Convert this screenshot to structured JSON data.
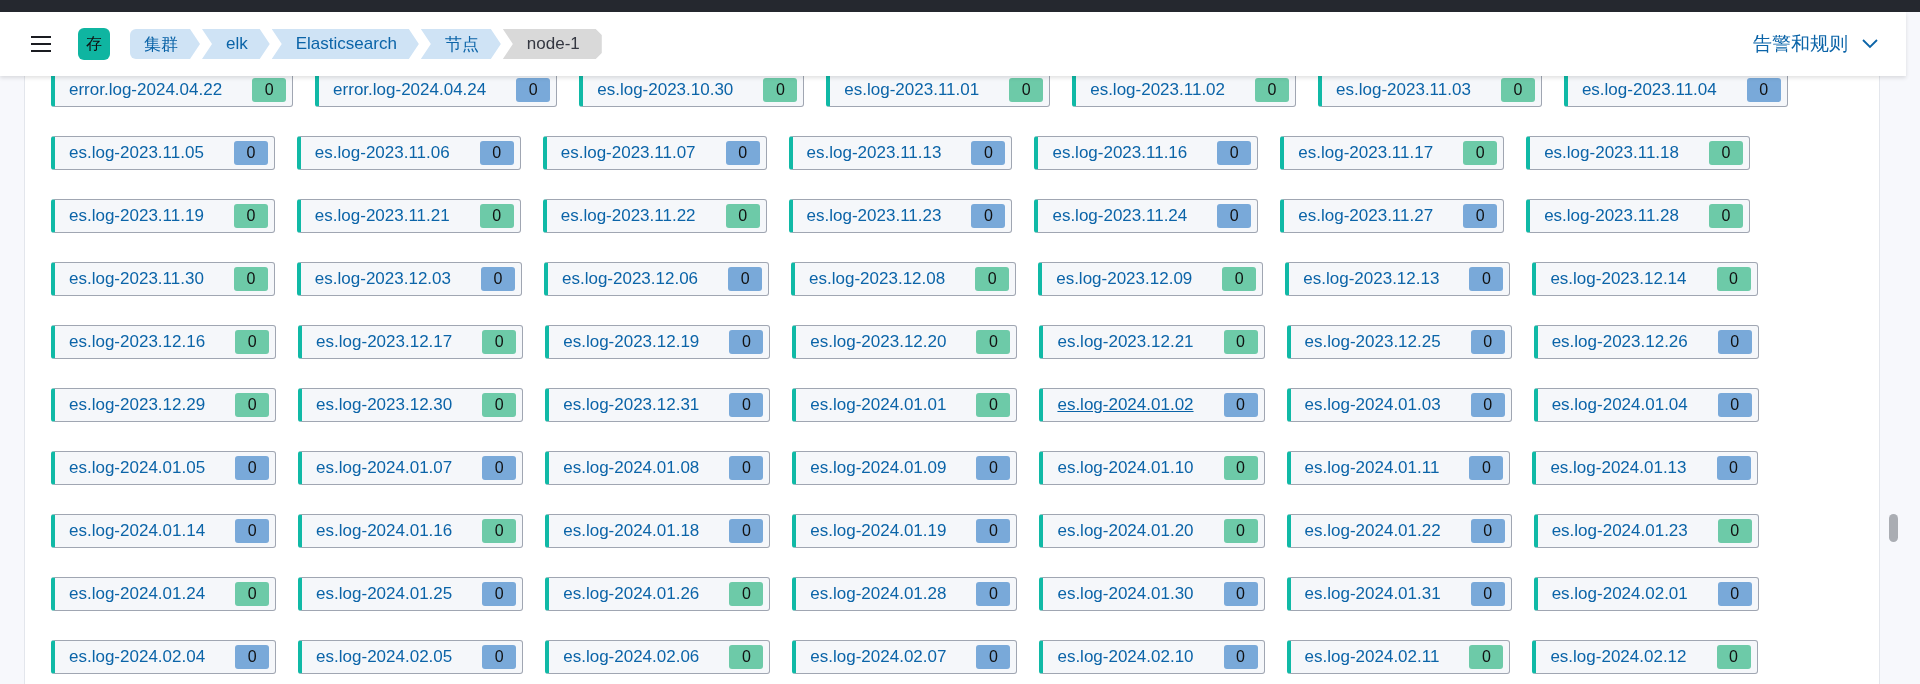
{
  "header": {
    "app_badge": "存",
    "breadcrumbs": [
      {
        "label": "集群",
        "current": false
      },
      {
        "label": "elk",
        "current": false
      },
      {
        "label": "Elasticsearch",
        "current": false
      },
      {
        "label": "节点",
        "current": false
      },
      {
        "label": "node-1",
        "current": true
      }
    ],
    "menu": "告警和规则"
  },
  "indices": [
    {
      "name": "error.log-2024.04.22",
      "count": "0",
      "color": "#6dcaa8",
      "hovered": false
    },
    {
      "name": "error.log-2024.04.24",
      "count": "0",
      "color": "#79a9d9",
      "hovered": false
    },
    {
      "name": "es.log-2023.10.30",
      "count": "0",
      "color": "#6dcaa8",
      "hovered": false
    },
    {
      "name": "es.log-2023.11.01",
      "count": "0",
      "color": "#6dcaa8",
      "hovered": false
    },
    {
      "name": "es.log-2023.11.02",
      "count": "0",
      "color": "#6dcaa8",
      "hovered": false
    },
    {
      "name": "es.log-2023.11.03",
      "count": "0",
      "color": "#6dcaa8",
      "hovered": false
    },
    {
      "name": "es.log-2023.11.04",
      "count": "0",
      "color": "#79a9d9",
      "hovered": false
    },
    {
      "name": "es.log-2023.11.05",
      "count": "0",
      "color": "#79a9d9",
      "hovered": false
    },
    {
      "name": "es.log-2023.11.06",
      "count": "0",
      "color": "#79a9d9",
      "hovered": false
    },
    {
      "name": "es.log-2023.11.07",
      "count": "0",
      "color": "#79a9d9",
      "hovered": false
    },
    {
      "name": "es.log-2023.11.13",
      "count": "0",
      "color": "#79a9d9",
      "hovered": false
    },
    {
      "name": "es.log-2023.11.16",
      "count": "0",
      "color": "#79a9d9",
      "hovered": false
    },
    {
      "name": "es.log-2023.11.17",
      "count": "0",
      "color": "#6dcaa8",
      "hovered": false
    },
    {
      "name": "es.log-2023.11.18",
      "count": "0",
      "color": "#6dcaa8",
      "hovered": false
    },
    {
      "name": "es.log-2023.11.19",
      "count": "0",
      "color": "#6dcaa8",
      "hovered": false
    },
    {
      "name": "es.log-2023.11.21",
      "count": "0",
      "color": "#6dcaa8",
      "hovered": false
    },
    {
      "name": "es.log-2023.11.22",
      "count": "0",
      "color": "#6dcaa8",
      "hovered": false
    },
    {
      "name": "es.log-2023.11.23",
      "count": "0",
      "color": "#79a9d9",
      "hovered": false
    },
    {
      "name": "es.log-2023.11.24",
      "count": "0",
      "color": "#79a9d9",
      "hovered": false
    },
    {
      "name": "es.log-2023.11.27",
      "count": "0",
      "color": "#79a9d9",
      "hovered": false
    },
    {
      "name": "es.log-2023.11.28",
      "count": "0",
      "color": "#6dcaa8",
      "hovered": false
    },
    {
      "name": "es.log-2023.11.30",
      "count": "0",
      "color": "#6dcaa8",
      "hovered": false
    },
    {
      "name": "es.log-2023.12.03",
      "count": "0",
      "color": "#79a9d9",
      "hovered": false
    },
    {
      "name": "es.log-2023.12.06",
      "count": "0",
      "color": "#79a9d9",
      "hovered": false
    },
    {
      "name": "es.log-2023.12.08",
      "count": "0",
      "color": "#6dcaa8",
      "hovered": false
    },
    {
      "name": "es.log-2023.12.09",
      "count": "0",
      "color": "#6dcaa8",
      "hovered": false
    },
    {
      "name": "es.log-2023.12.13",
      "count": "0",
      "color": "#79a9d9",
      "hovered": false
    },
    {
      "name": "es.log-2023.12.14",
      "count": "0",
      "color": "#6dcaa8",
      "hovered": false
    },
    {
      "name": "es.log-2023.12.16",
      "count": "0",
      "color": "#6dcaa8",
      "hovered": false
    },
    {
      "name": "es.log-2023.12.17",
      "count": "0",
      "color": "#6dcaa8",
      "hovered": false
    },
    {
      "name": "es.log-2023.12.19",
      "count": "0",
      "color": "#79a9d9",
      "hovered": false
    },
    {
      "name": "es.log-2023.12.20",
      "count": "0",
      "color": "#6dcaa8",
      "hovered": false
    },
    {
      "name": "es.log-2023.12.21",
      "count": "0",
      "color": "#6dcaa8",
      "hovered": false
    },
    {
      "name": "es.log-2023.12.25",
      "count": "0",
      "color": "#79a9d9",
      "hovered": false
    },
    {
      "name": "es.log-2023.12.26",
      "count": "0",
      "color": "#79a9d9",
      "hovered": false
    },
    {
      "name": "es.log-2023.12.29",
      "count": "0",
      "color": "#6dcaa8",
      "hovered": false
    },
    {
      "name": "es.log-2023.12.30",
      "count": "0",
      "color": "#6dcaa8",
      "hovered": false
    },
    {
      "name": "es.log-2023.12.31",
      "count": "0",
      "color": "#79a9d9",
      "hovered": false
    },
    {
      "name": "es.log-2024.01.01",
      "count": "0",
      "color": "#6dcaa8",
      "hovered": false
    },
    {
      "name": "es.log-2024.01.02",
      "count": "0",
      "color": "#79a9d9",
      "hovered": true
    },
    {
      "name": "es.log-2024.01.03",
      "count": "0",
      "color": "#79a9d9",
      "hovered": false
    },
    {
      "name": "es.log-2024.01.04",
      "count": "0",
      "color": "#79a9d9",
      "hovered": false
    },
    {
      "name": "es.log-2024.01.05",
      "count": "0",
      "color": "#79a9d9",
      "hovered": false
    },
    {
      "name": "es.log-2024.01.07",
      "count": "0",
      "color": "#79a9d9",
      "hovered": false
    },
    {
      "name": "es.log-2024.01.08",
      "count": "0",
      "color": "#79a9d9",
      "hovered": false
    },
    {
      "name": "es.log-2024.01.09",
      "count": "0",
      "color": "#79a9d9",
      "hovered": false
    },
    {
      "name": "es.log-2024.01.10",
      "count": "0",
      "color": "#6dcaa8",
      "hovered": false
    },
    {
      "name": "es.log-2024.01.11",
      "count": "0",
      "color": "#79a9d9",
      "hovered": false
    },
    {
      "name": "es.log-2024.01.13",
      "count": "0",
      "color": "#79a9d9",
      "hovered": false
    },
    {
      "name": "es.log-2024.01.14",
      "count": "0",
      "color": "#79a9d9",
      "hovered": false
    },
    {
      "name": "es.log-2024.01.16",
      "count": "0",
      "color": "#6dcaa8",
      "hovered": false
    },
    {
      "name": "es.log-2024.01.18",
      "count": "0",
      "color": "#79a9d9",
      "hovered": false
    },
    {
      "name": "es.log-2024.01.19",
      "count": "0",
      "color": "#79a9d9",
      "hovered": false
    },
    {
      "name": "es.log-2024.01.20",
      "count": "0",
      "color": "#6dcaa8",
      "hovered": false
    },
    {
      "name": "es.log-2024.01.22",
      "count": "0",
      "color": "#79a9d9",
      "hovered": false
    },
    {
      "name": "es.log-2024.01.23",
      "count": "0",
      "color": "#6dcaa8",
      "hovered": false
    },
    {
      "name": "es.log-2024.01.24",
      "count": "0",
      "color": "#6dcaa8",
      "hovered": false
    },
    {
      "name": "es.log-2024.01.25",
      "count": "0",
      "color": "#79a9d9",
      "hovered": false
    },
    {
      "name": "es.log-2024.01.26",
      "count": "0",
      "color": "#6dcaa8",
      "hovered": false
    },
    {
      "name": "es.log-2024.01.28",
      "count": "0",
      "color": "#79a9d9",
      "hovered": false
    },
    {
      "name": "es.log-2024.01.30",
      "count": "0",
      "color": "#79a9d9",
      "hovered": false
    },
    {
      "name": "es.log-2024.01.31",
      "count": "0",
      "color": "#79a9d9",
      "hovered": false
    },
    {
      "name": "es.log-2024.02.01",
      "count": "0",
      "color": "#79a9d9",
      "hovered": false
    },
    {
      "name": "es.log-2024.02.04",
      "count": "0",
      "color": "#79a9d9",
      "hovered": false
    },
    {
      "name": "es.log-2024.02.05",
      "count": "0",
      "color": "#79a9d9",
      "hovered": false
    },
    {
      "name": "es.log-2024.02.06",
      "count": "0",
      "color": "#6dcaa8",
      "hovered": false
    },
    {
      "name": "es.log-2024.02.07",
      "count": "0",
      "color": "#79a9d9",
      "hovered": false
    },
    {
      "name": "es.log-2024.02.10",
      "count": "0",
      "color": "#79a9d9",
      "hovered": false
    },
    {
      "name": "es.log-2024.02.11",
      "count": "0",
      "color": "#6dcaa8",
      "hovered": false
    },
    {
      "name": "es.log-2024.02.12",
      "count": "0",
      "color": "#6dcaa8",
      "hovered": false
    }
  ]
}
